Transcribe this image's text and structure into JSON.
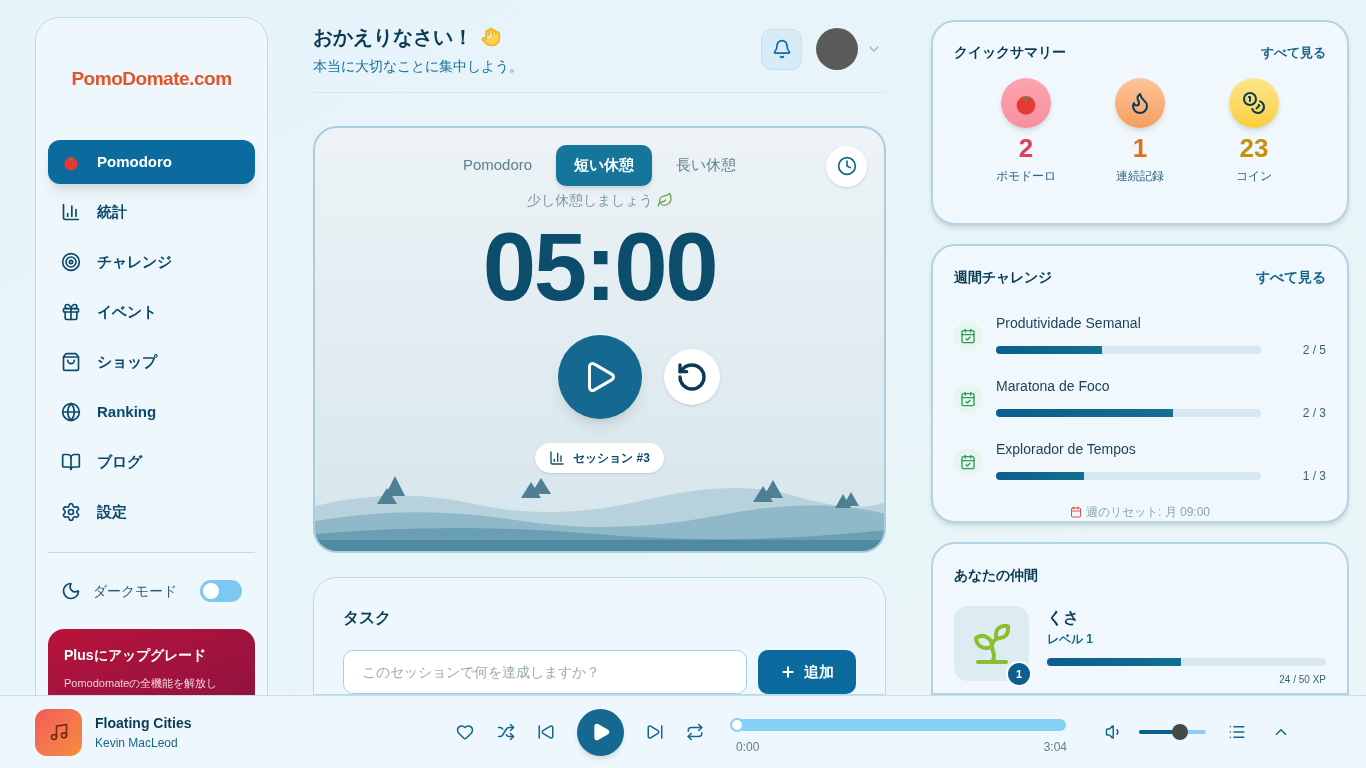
{
  "sidebar": {
    "logo": "PomoDomate.com",
    "items": [
      {
        "label": "Pomodoro",
        "kind": "tomato",
        "selected": true
      },
      {
        "label": "統計",
        "kind": "chart",
        "selected": false
      },
      {
        "label": "チャレンジ",
        "kind": "target",
        "selected": false
      },
      {
        "label": "イベント",
        "kind": "gift",
        "selected": false
      },
      {
        "label": "ショップ",
        "kind": "bag",
        "selected": false
      },
      {
        "label": "Ranking",
        "kind": "globe",
        "selected": false
      },
      {
        "label": "ブログ",
        "kind": "book",
        "selected": false
      },
      {
        "label": "設定",
        "kind": "gear",
        "selected": false
      }
    ],
    "dark_mode": {
      "label": "ダークモード",
      "on": false
    },
    "upgrade": {
      "title": "Plusにアップグレード",
      "text": "Pomodomateの全機能を解放し"
    }
  },
  "header": {
    "greeting": "おかえりなさい！",
    "subtitle": "本当に大切なことに集中しよう。"
  },
  "timer": {
    "tabs": [
      {
        "label": "Pomodoro",
        "selected": false
      },
      {
        "label": "短い休憩",
        "selected": true
      },
      {
        "label": "長い休憩",
        "selected": false
      }
    ],
    "message": "少し休憩しましょう",
    "time": "05:00",
    "session": "セッション #3"
  },
  "tasks": {
    "title": "タスク",
    "placeholder": "このセッションで何を達成しますか？",
    "add_button": "追加"
  },
  "summary": {
    "title": "クイックサマリー",
    "link": "すべて見る",
    "stats": [
      {
        "kind": "tomato",
        "value": "2",
        "label": "ポモドーロ",
        "color": "#e0405a"
      },
      {
        "kind": "flame",
        "value": "1",
        "label": "連続記録",
        "color": "#e07020"
      },
      {
        "kind": "coins",
        "value": "23",
        "label": "コイン",
        "color": "#c8900a"
      }
    ]
  },
  "challenges": {
    "title": "週間チャレンジ",
    "link": "すべて見る",
    "items": [
      {
        "name": "Produtividade Semanal",
        "level": 0.4,
        "progress": "2 / 5"
      },
      {
        "name": "Maratona de Foco",
        "level": 0.667,
        "progress": "2 / 3"
      },
      {
        "name": "Explorador de Tempos",
        "level": 0.333,
        "progress": "1 / 3"
      }
    ],
    "reset": "週のリセット: 月 09:00"
  },
  "companion": {
    "title": "あなたの仲間",
    "name": "くさ",
    "level_label": "レベル 1",
    "badge": "1",
    "level": 0.48,
    "xp": "24 / 50 XP"
  },
  "player": {
    "title": "Floating Cities",
    "artist": "Kevin MacLeod",
    "liked": false,
    "elapsed": "0:00",
    "duration": "3:04",
    "level": 0,
    "volume": {
      "level": 0.65
    }
  }
}
